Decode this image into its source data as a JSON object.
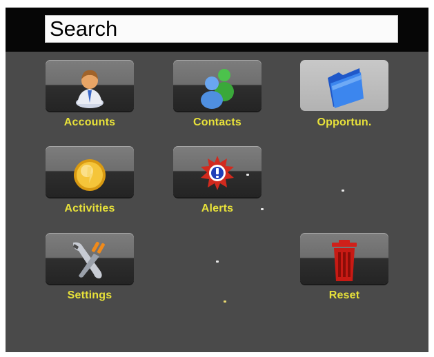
{
  "search": {
    "placeholder": "Search"
  },
  "tiles": [
    {
      "label": "Accounts",
      "icon": "person-icon"
    },
    {
      "label": "Contacts",
      "icon": "people-icon"
    },
    {
      "label": "Opportun.",
      "icon": "folder-icon",
      "selected": true
    },
    {
      "label": "Activities",
      "icon": "coin-icon"
    },
    {
      "label": "Alerts",
      "icon": "alert-icon"
    },
    {
      "label": "Settings",
      "icon": "tools-icon"
    },
    {
      "label": "Reset",
      "icon": "trash-icon"
    }
  ],
  "colors": {
    "background": "#4a4a4a",
    "topbar": "#060606",
    "label": "#e8e23a"
  }
}
